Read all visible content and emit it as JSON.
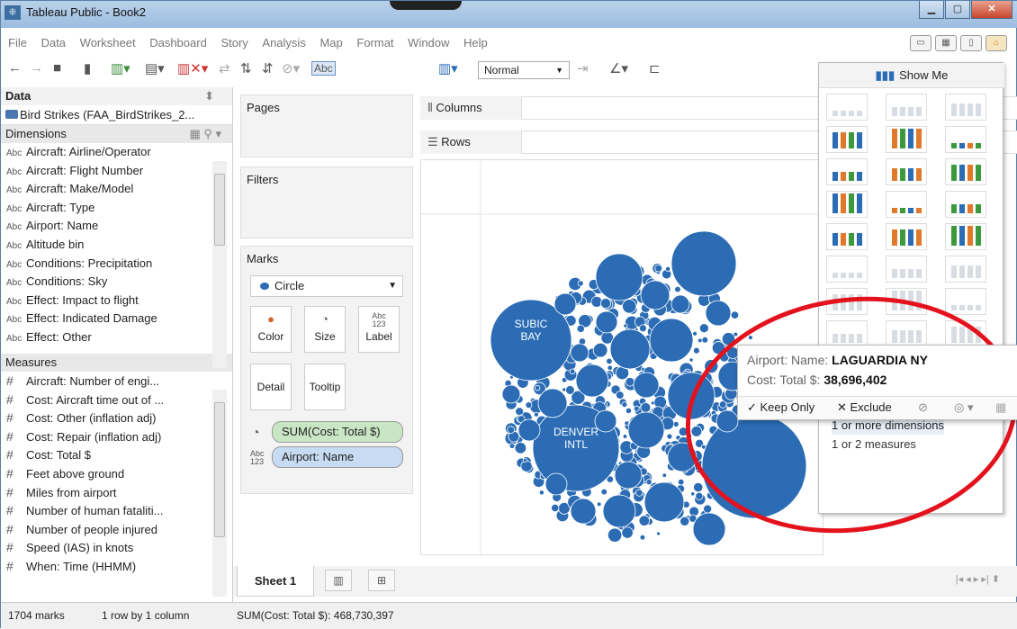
{
  "window": {
    "title": "Tableau Public - Book2"
  },
  "menu": [
    "File",
    "Data",
    "Worksheet",
    "Dashboard",
    "Story",
    "Analysis",
    "Map",
    "Format",
    "Window",
    "Help"
  ],
  "toolbar": {
    "label_mode": "Normal",
    "abc": "Abc"
  },
  "data_pane": {
    "header": "Data",
    "datasource": "Bird Strikes (FAA_BirdStrikes_2...",
    "dimensions_label": "Dimensions",
    "dimensions": [
      "Aircraft: Airline/Operator",
      "Aircraft: Flight Number",
      "Aircraft: Make/Model",
      "Aircraft: Type",
      "Airport: Name",
      "Altitude bin",
      "Conditions: Precipitation",
      "Conditions: Sky",
      "Effect: Impact to flight",
      "Effect: Indicated Damage",
      "Effect: Other"
    ],
    "dim_icon": "Abc",
    "measures_label": "Measures",
    "measures": [
      "Aircraft: Number of engi...",
      "Cost: Aircraft time out of ...",
      "Cost: Other (inflation adj)",
      "Cost: Repair (inflation adj)",
      "Cost: Total $",
      "Feet above ground",
      "Miles from airport",
      "Number of human fataliti...",
      "Number of people injured",
      "Speed (IAS) in knots",
      "When: Time (HHMM)"
    ],
    "measure_icon": "#"
  },
  "pages": {
    "label": "Pages"
  },
  "filters": {
    "label": "Filters"
  },
  "marks": {
    "label": "Marks",
    "type": "Circle",
    "buttons": [
      {
        "label": "Color",
        "icon": "color-icon"
      },
      {
        "label": "Size",
        "icon": "size-icon"
      },
      {
        "label": "Label",
        "icon": "label-icon"
      },
      {
        "label": "Detail",
        "icon": "detail-icon"
      },
      {
        "label": "Tooltip",
        "icon": "tooltip-icon"
      }
    ],
    "label_icon_text": "Abc\n123",
    "pills": [
      {
        "text": "SUM(Cost: Total $)",
        "color": "#c9e6c4"
      },
      {
        "text": "Airport: Name",
        "color": "#c7dbf2"
      }
    ]
  },
  "shelves": {
    "columns": "Columns",
    "rows": "Rows"
  },
  "viz": {
    "bubble_color": "#2b6cb5",
    "labels": [
      "SUBIC BAY",
      "DENVER INTL"
    ]
  },
  "show_me": {
    "title": "Show Me",
    "hint_dims": "1 or more dimensions",
    "hint_meas": "1 or 2 measures"
  },
  "tooltip": {
    "name_label": "Airport: Name:",
    "name_value": "LAGUARDIA NY",
    "cost_label": "Cost: Total $:",
    "cost_value": "38,696,402",
    "keep_only": "✓ Keep Only",
    "exclude": "✕ Exclude"
  },
  "tabs": {
    "sheet": "Sheet 1"
  },
  "status": {
    "marks": "1704 marks",
    "rows_cols": "1 row by 1 column",
    "sum": "SUM(Cost: Total $): 468,730,397"
  },
  "annotation_color": "#e3121c"
}
